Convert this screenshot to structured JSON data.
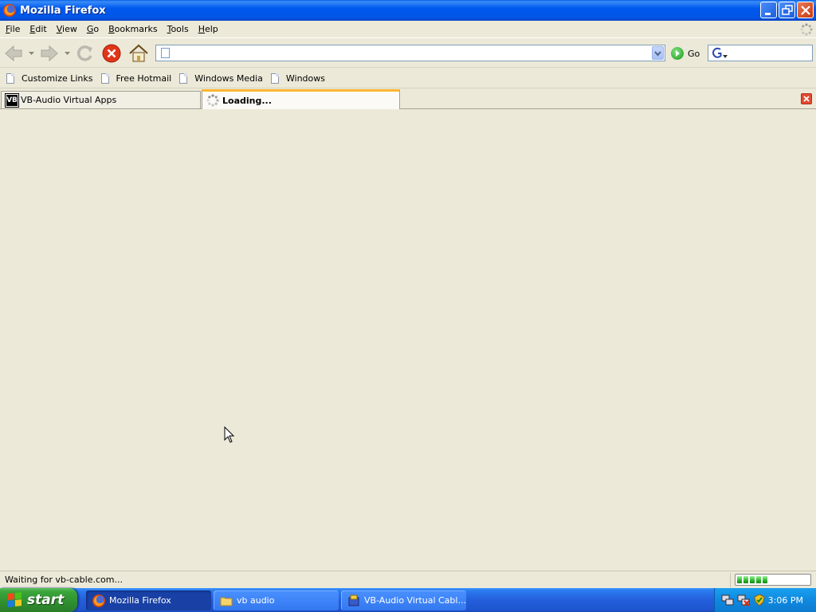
{
  "window": {
    "title": "Mozilla Firefox"
  },
  "menubar": {
    "items": [
      {
        "label": "File",
        "accel": "F",
        "rest": "ile"
      },
      {
        "label": "Edit",
        "accel": "E",
        "rest": "dit"
      },
      {
        "label": "View",
        "accel": "V",
        "rest": "iew"
      },
      {
        "label": "Go",
        "accel": "G",
        "rest": "o"
      },
      {
        "label": "Bookmarks",
        "accel": "B",
        "rest": "ookmarks"
      },
      {
        "label": "Tools",
        "accel": "T",
        "rest": "ools"
      },
      {
        "label": "Help",
        "accel": "H",
        "rest": "elp"
      }
    ]
  },
  "navbar": {
    "url_value": "",
    "go_label": "Go",
    "search_value": ""
  },
  "bookmarks": {
    "items": [
      "Customize Links",
      "Free Hotmail",
      "Windows Media",
      "Windows"
    ]
  },
  "tabs": [
    {
      "label": "VB-Audio Virtual Apps",
      "favicon_text": "VB",
      "active": false
    },
    {
      "label": "Loading...",
      "active": true
    }
  ],
  "statusbar": {
    "text": "Waiting for vb-cable.com...",
    "progress_segments_filled": 5
  },
  "taskbar": {
    "start_label": "start",
    "buttons": [
      {
        "label": "Mozilla Firefox",
        "icon": "firefox-icon",
        "active": true
      },
      {
        "label": "vb audio",
        "icon": "folder-icon",
        "active": false
      },
      {
        "label": "VB-Audio Virtual Cabl...",
        "icon": "installer-icon",
        "active": false
      }
    ],
    "clock": "3:06 PM"
  },
  "colors": {
    "titlebar": "#0058ee",
    "chrome": "#ece9d8",
    "active_tab_accent": "#ffb730",
    "taskbar": "#245edb",
    "start_green": "#3aa53a",
    "progress_green": "#2cb52c"
  }
}
